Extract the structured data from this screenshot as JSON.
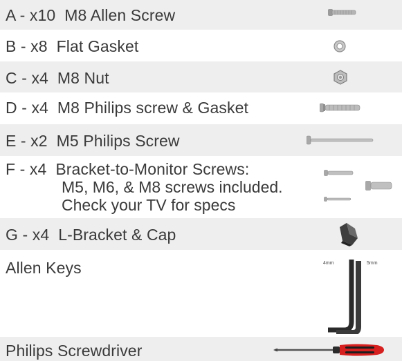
{
  "items": [
    {
      "label": "A - x10  M8 Allen Screw",
      "image": "allen-screw-icon"
    },
    {
      "label": "B - x8  Flat Gasket",
      "image": "flat-gasket-icon"
    },
    {
      "label": "C - x4  M8 Nut",
      "image": "nut-icon"
    },
    {
      "label": "D - x4  M8 Philips screw & Gasket",
      "image": "philips-screw-gasket-icon"
    },
    {
      "label": "E - x2  M5 Philips Screw",
      "image": "long-screw-icon"
    },
    {
      "label": "F - x4  Bracket-to-Monitor Screws:",
      "lines": [
        "M5, M6, & M8 screws included.",
        "Check your TV for specs"
      ],
      "image": "monitor-screws-icon"
    },
    {
      "label": "G - x4  L-Bracket & Cap",
      "image": "l-bracket-icon"
    },
    {
      "label": "Allen Keys",
      "key_sizes": [
        "4mm",
        "5mm"
      ],
      "image": "allen-keys-icon"
    },
    {
      "label": "Philips Screwdriver",
      "image": "screwdriver-icon"
    }
  ],
  "colors": {
    "shade": "#eeeeee",
    "text": "#3a3a3a",
    "handle": "#d61f1f"
  }
}
